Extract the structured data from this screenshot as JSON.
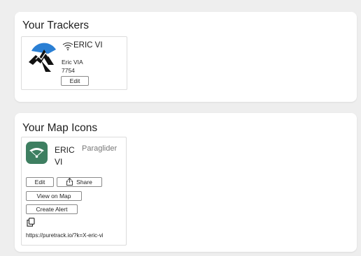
{
  "trackers": {
    "title": "Your Trackers",
    "items": [
      {
        "name": "ERIC VI",
        "owner": "Eric VIA",
        "id": "7754",
        "edit_label": "Edit",
        "icons": [
          "brand-logo",
          "wifi-icon"
        ]
      }
    ]
  },
  "map_icons": {
    "title": "Your Map Icons",
    "items": [
      {
        "name": "ERIC VI",
        "type": "Paraglider",
        "badge_icon": "paraglider-icon",
        "badge_color": "#3e7f61",
        "buttons": {
          "edit": "Edit",
          "share": "Share",
          "view_map": "View on Map",
          "create_alert": "Create Alert"
        },
        "copy_icon": "copy-icon",
        "share_url": "https://puretrack.io/?k=X-eric-vi"
      }
    ]
  },
  "colors": {
    "background": "#eeeeee",
    "card": "#ffffff",
    "badge": "#3e7f61",
    "logo_blue": "#2a7fd4"
  }
}
